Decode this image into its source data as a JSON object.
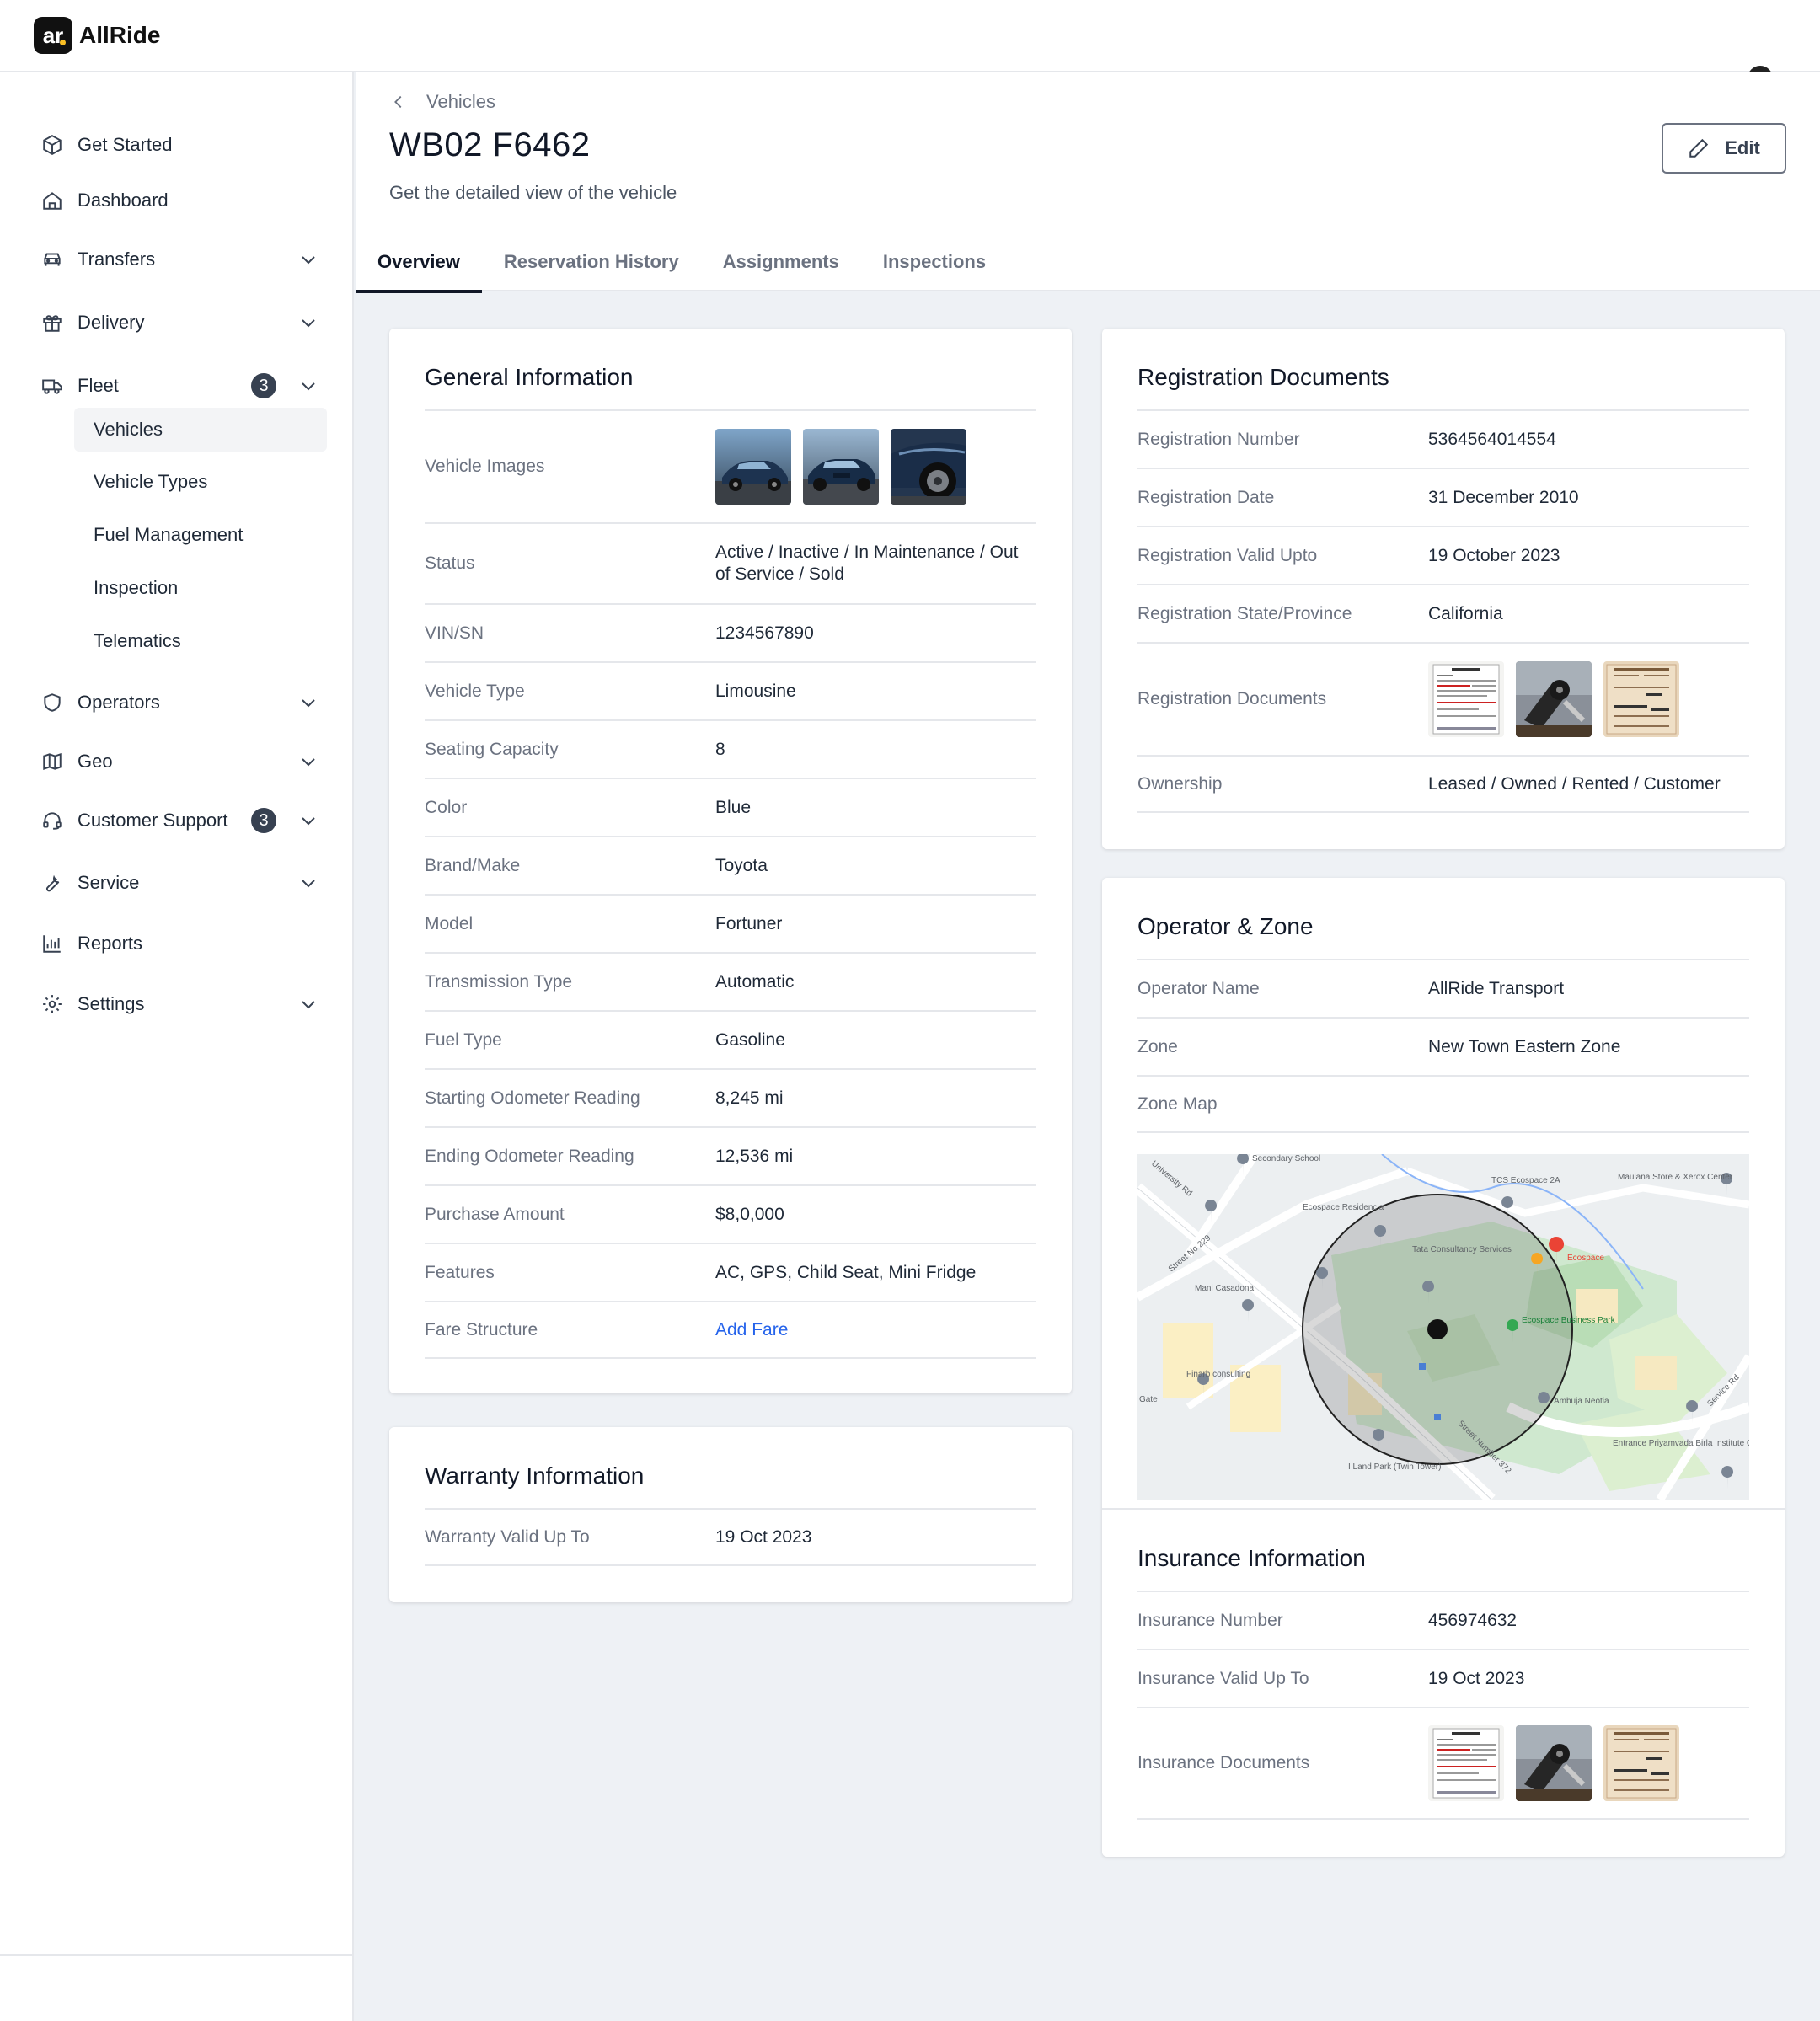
{
  "app": {
    "name": "AllRide",
    "logo_mark": "ar"
  },
  "sidebar": {
    "items": [
      {
        "label": "Get Started",
        "icon": "cube-icon"
      },
      {
        "label": "Dashboard",
        "icon": "home-icon"
      },
      {
        "label": "Transfers",
        "icon": "car-icon",
        "expandable": true
      },
      {
        "label": "Delivery",
        "icon": "gift-icon",
        "expandable": true
      },
      {
        "label": "Fleet",
        "icon": "truck-icon",
        "expandable": true,
        "badge": "3"
      },
      {
        "label": "Operators",
        "icon": "shield-icon",
        "expandable": true
      },
      {
        "label": "Geo",
        "icon": "map-icon",
        "expandable": true
      },
      {
        "label": "Customer Support",
        "icon": "headset-icon",
        "expandable": true,
        "badge": "3"
      },
      {
        "label": "Service",
        "icon": "wrench-icon",
        "expandable": true
      },
      {
        "label": "Reports",
        "icon": "bar-chart-icon"
      },
      {
        "label": "Settings",
        "icon": "gear-icon",
        "expandable": true
      }
    ],
    "fleet_sub": [
      "Vehicles",
      "Vehicle Types",
      "Fuel Management",
      "Inspection",
      "Telematics"
    ],
    "active_sub": "Vehicles"
  },
  "header": {
    "breadcrumb": "Vehicles",
    "title": "WB02 F6462",
    "subtitle": "Get the detailed view of the vehicle",
    "edit_label": "Edit",
    "tabs": [
      "Overview",
      "Reservation History",
      "Assignments",
      "Inspections"
    ],
    "active_tab": "Overview"
  },
  "general": {
    "title": "General Information",
    "images_label": "Vehicle Images",
    "rows": [
      {
        "label": "Status",
        "value": "Active / Inactive / In Maintenance / Out of Service / Sold"
      },
      {
        "label": "VIN/SN",
        "value": "1234567890"
      },
      {
        "label": "Vehicle Type",
        "value": "Limousine"
      },
      {
        "label": "Seating Capacity",
        "value": "8"
      },
      {
        "label": "Color",
        "value": "Blue"
      },
      {
        "label": "Brand/Make",
        "value": "Toyota"
      },
      {
        "label": "Model",
        "value": "Fortuner"
      },
      {
        "label": "Transmission Type",
        "value": "Automatic"
      },
      {
        "label": "Fuel Type",
        "value": "Gasoline"
      },
      {
        "label": "Starting Odometer Reading",
        "value": "8,245 mi"
      },
      {
        "label": "Ending Odometer Reading",
        "value": "12,536 mi"
      },
      {
        "label": "Purchase Amount",
        "value": "$8,0,000"
      },
      {
        "label": "Features",
        "value": "AC, GPS, Child Seat, Mini Fridge"
      },
      {
        "label": "Fare Structure",
        "value": "Add Fare"
      }
    ]
  },
  "warranty": {
    "title": "Warranty Information",
    "label": "Warranty Valid Up To",
    "value": "19 Oct 2023"
  },
  "registration": {
    "title": "Registration Documents",
    "rows": [
      {
        "label": "Registration Number",
        "value": "5364564014554"
      },
      {
        "label": "Registration Date",
        "value": "31 December 2010"
      },
      {
        "label": "Registration Valid Upto",
        "value": "19 October 2023"
      },
      {
        "label": "Registration State/Province",
        "value": "California"
      }
    ],
    "docs_label": "Registration Documents",
    "ownership_label": "Ownership",
    "ownership_value": "Leased / Owned / Rented / Customer"
  },
  "operator": {
    "title": "Operator & Zone",
    "rows": [
      {
        "label": "Operator Name",
        "value": "AllRide Transport"
      },
      {
        "label": "Zone",
        "value": "New Town Eastern Zone"
      }
    ],
    "map_label": "Zone Map",
    "map_labels": {
      "secondary_school": "Secondary School",
      "tcs_ecospace": "TCS Ecospace 2A",
      "maulana_store": "Maulana Store & Xerox Center",
      "ecospace_residence": "Ecospace Residencia",
      "tata": "Tata Consultancy Services",
      "ecospace": "Ecospace",
      "mani": "Mani Casadona",
      "business_park": "Ecospace Business Park",
      "finarb": "Finarb consulting",
      "ambuja": "Ambuja Neotia",
      "land_park": "I Land Park (Twin Tower)",
      "birla": "Entrance Priyamvada Birla Institute Of Nursing",
      "university_rd": "University Rd",
      "street_372": "Street Number 372",
      "service_rd": "Service Rd",
      "street_229": "Street No 229",
      "gate": "Gate"
    }
  },
  "insurance": {
    "title": "Insurance Information",
    "rows": [
      {
        "label": "Insurance Number",
        "value": "456974632"
      },
      {
        "label": "Insurance Valid Up To",
        "value": "19 Oct 2023"
      }
    ],
    "docs_label": "Insurance Documents"
  },
  "colors": {
    "accent_link": "#2563eb",
    "map_marker_red": "#ea4335",
    "map_green": "#c8e6c9"
  }
}
